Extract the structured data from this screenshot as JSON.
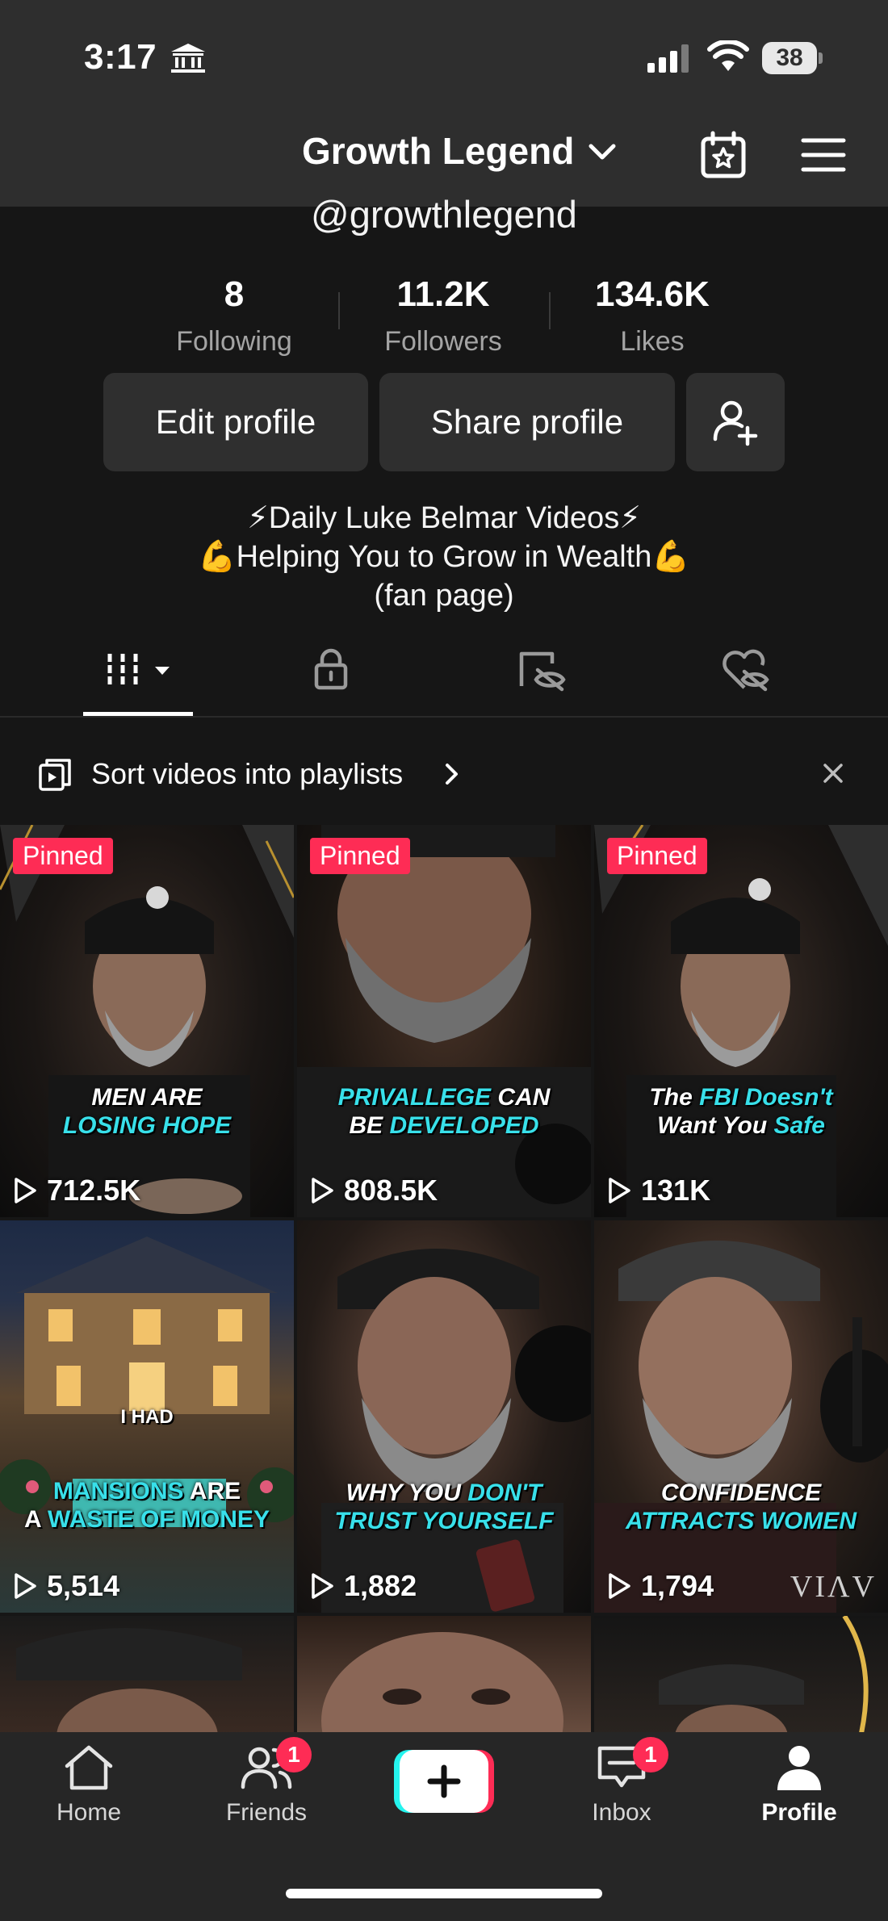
{
  "status": {
    "time": "3:17",
    "battery": "38"
  },
  "header": {
    "title": "Growth Legend",
    "handle": "@growthlegend"
  },
  "stats": [
    {
      "value": "8",
      "label": "Following"
    },
    {
      "value": "11.2K",
      "label": "Followers"
    },
    {
      "value": "134.6K",
      "label": "Likes"
    }
  ],
  "actions": {
    "edit": "Edit profile",
    "share": "Share profile"
  },
  "bio": {
    "line1": "⚡Daily Luke Belmar Videos⚡",
    "line2": "💪Helping You to Grow in Wealth💪",
    "line3": "(fan page)"
  },
  "playlist_banner": {
    "text": "Sort videos into playlists"
  },
  "videos": [
    {
      "pinned": "Pinned",
      "cap1a": "MEN ARE",
      "cap1b": "",
      "cap2a": "",
      "cap2b": "LOSING HOPE",
      "views": "712.5K"
    },
    {
      "pinned": "Pinned",
      "cap1a": "",
      "cap1b": "PRIVALLEGE",
      "cap1c": " CAN",
      "cap2a": "BE ",
      "cap2b": "DEVELOPED",
      "views": "808.5K"
    },
    {
      "pinned": "Pinned",
      "cap1a": "The ",
      "cap1b": "FBI Doesn't",
      "cap2a": "Want You ",
      "cap2b": "Safe",
      "views": "131K"
    },
    {
      "cap0": "I HAD",
      "cap1b": "MANSIONS",
      "cap1c": " ARE",
      "cap2a": "A ",
      "cap2b": "WASTE OF MONEY",
      "views": "5,514"
    },
    {
      "cap1a": "WHY YOU ",
      "cap1b": "DON'T",
      "cap2a": "",
      "cap2b": "TRUST YOURSELF",
      "views": "1,882"
    },
    {
      "cap1a": "CONFIDENCE",
      "cap1b": "",
      "cap2a": "",
      "cap2b": "ATTRACTS WOMEN",
      "views": "1,794",
      "mark": "VIΛV"
    }
  ],
  "tabbar": {
    "home": "Home",
    "friends": "Friends",
    "friends_badge": "1",
    "inbox": "Inbox",
    "inbox_badge": "1",
    "profile": "Profile"
  },
  "colors": {
    "accent_red": "#fe2c55",
    "accent_cyan": "#25f4ee",
    "caption_cyan": "#38e0ea",
    "bg": "#161616",
    "bar": "#2e2e2e"
  }
}
